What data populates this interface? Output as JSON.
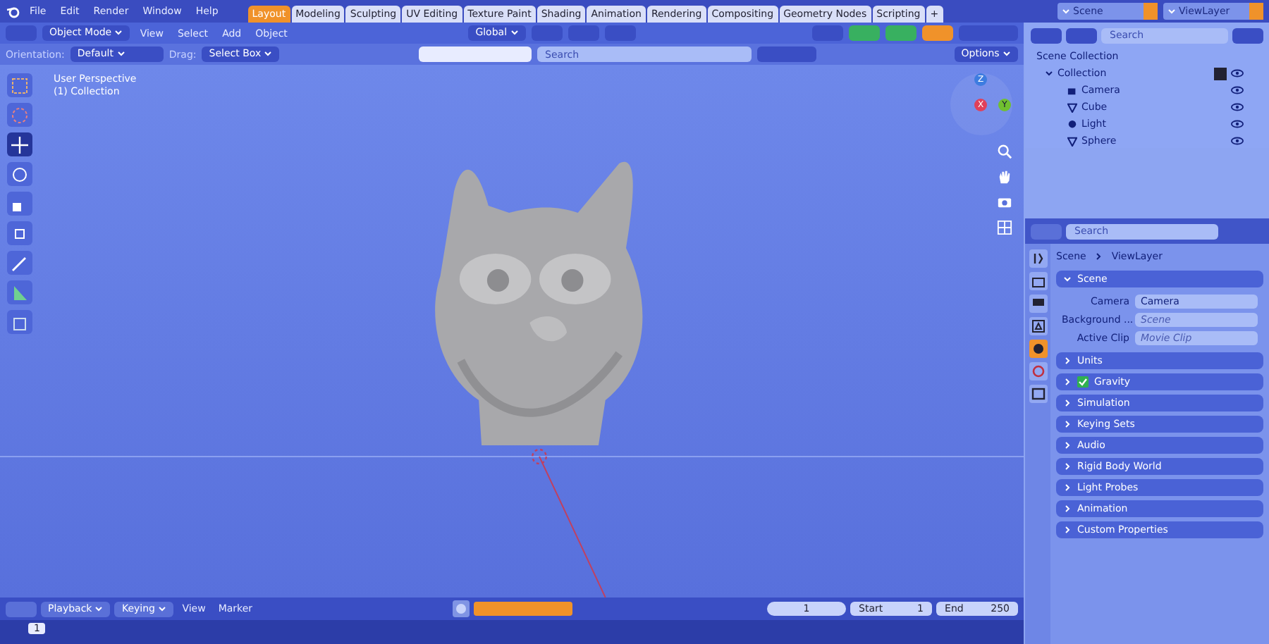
{
  "top_bar": {
    "menus": [
      "File",
      "Edit",
      "Render",
      "Window",
      "Help"
    ],
    "workspace_tabs": [
      {
        "label": "Layout",
        "selected": true
      },
      {
        "label": "Modeling",
        "selected": false
      },
      {
        "label": "Sculpting",
        "selected": false
      },
      {
        "label": "UV Editing",
        "selected": false
      },
      {
        "label": "Texture Paint",
        "selected": false
      },
      {
        "label": "Shading",
        "selected": false
      },
      {
        "label": "Animation",
        "selected": false
      },
      {
        "label": "Rendering",
        "selected": false
      },
      {
        "label": "Compositing",
        "selected": false
      },
      {
        "label": "Geometry Nodes",
        "selected": false
      },
      {
        "label": "Scripting",
        "selected": false
      }
    ],
    "add_tab": "+",
    "scene": "Scene",
    "view_layer": "ViewLayer"
  },
  "viewport_header": {
    "mode": "Object Mode",
    "menus": [
      "View",
      "Select",
      "Add",
      "Object"
    ],
    "transform_orientation": "Global"
  },
  "tool_settings": {
    "orientation_label": "Orientation:",
    "orientation": "Default",
    "drag_label": "Drag:",
    "drag": "Select Box",
    "search_placeholder": "Search",
    "options": "Options"
  },
  "viewport": {
    "overlay_text": [
      "User Perspective",
      "(1) Collection"
    ],
    "tools": [
      {
        "kind": "select",
        "selected": false
      },
      {
        "kind": "cursor",
        "selected": false
      },
      {
        "kind": "move",
        "selected": true
      },
      {
        "kind": "rotate",
        "selected": false
      },
      {
        "kind": "scale",
        "selected": false
      },
      {
        "kind": "transform",
        "selected": false
      },
      {
        "kind": "annotate",
        "selected": false
      },
      {
        "kind": "measure",
        "selected": false
      },
      {
        "kind": "add",
        "selected": false
      }
    ],
    "gizmo": {
      "z": "Z",
      "x": "X",
      "y": "Y"
    }
  },
  "outliner": {
    "search_placeholder": "Search",
    "root": "Scene Collection",
    "collection": {
      "name": "Collection",
      "included": true,
      "expanded": true,
      "children": [
        {
          "name": "Camera",
          "kind": "camera"
        },
        {
          "name": "Cube",
          "kind": "mesh"
        },
        {
          "name": "Light",
          "kind": "light"
        },
        {
          "name": "Sphere",
          "kind": "mesh"
        }
      ]
    }
  },
  "properties": {
    "search_placeholder": "Search",
    "breadcrumb": [
      "Scene",
      "ViewLayer"
    ],
    "tabs": [
      {
        "kind": "tool",
        "selected": false
      },
      {
        "kind": "render",
        "selected": false
      },
      {
        "kind": "output",
        "selected": false
      },
      {
        "kind": "view_layer",
        "selected": false
      },
      {
        "kind": "scene",
        "selected": true
      },
      {
        "kind": "world",
        "selected": false
      },
      {
        "kind": "collection",
        "selected": false
      }
    ],
    "panels": [
      {
        "title": "Scene",
        "expanded": true,
        "fields": [
          {
            "label": "Camera",
            "value": "Camera",
            "placeholder": false
          },
          {
            "label": "Background ...",
            "value": "Scene",
            "placeholder": true
          },
          {
            "label": "Active Clip",
            "value": "Movie Clip",
            "placeholder": true
          }
        ]
      },
      {
        "title": "Units",
        "expanded": false
      },
      {
        "title": "Gravity",
        "expanded": false,
        "checked": true
      },
      {
        "title": "Simulation",
        "expanded": false
      },
      {
        "title": "Keying Sets",
        "expanded": false
      },
      {
        "title": "Audio",
        "expanded": false
      },
      {
        "title": "Rigid Body World",
        "expanded": false
      },
      {
        "title": "Light Probes",
        "expanded": false
      },
      {
        "title": "Animation",
        "expanded": false
      },
      {
        "title": "Custom Properties",
        "expanded": false
      }
    ]
  },
  "timeline": {
    "menus": [
      "Playback",
      "Keying",
      "View",
      "Marker"
    ],
    "current_frame": "1",
    "start_label": "Start",
    "start": "1",
    "end_label": "End",
    "end": "250",
    "frame_marker": "1"
  }
}
